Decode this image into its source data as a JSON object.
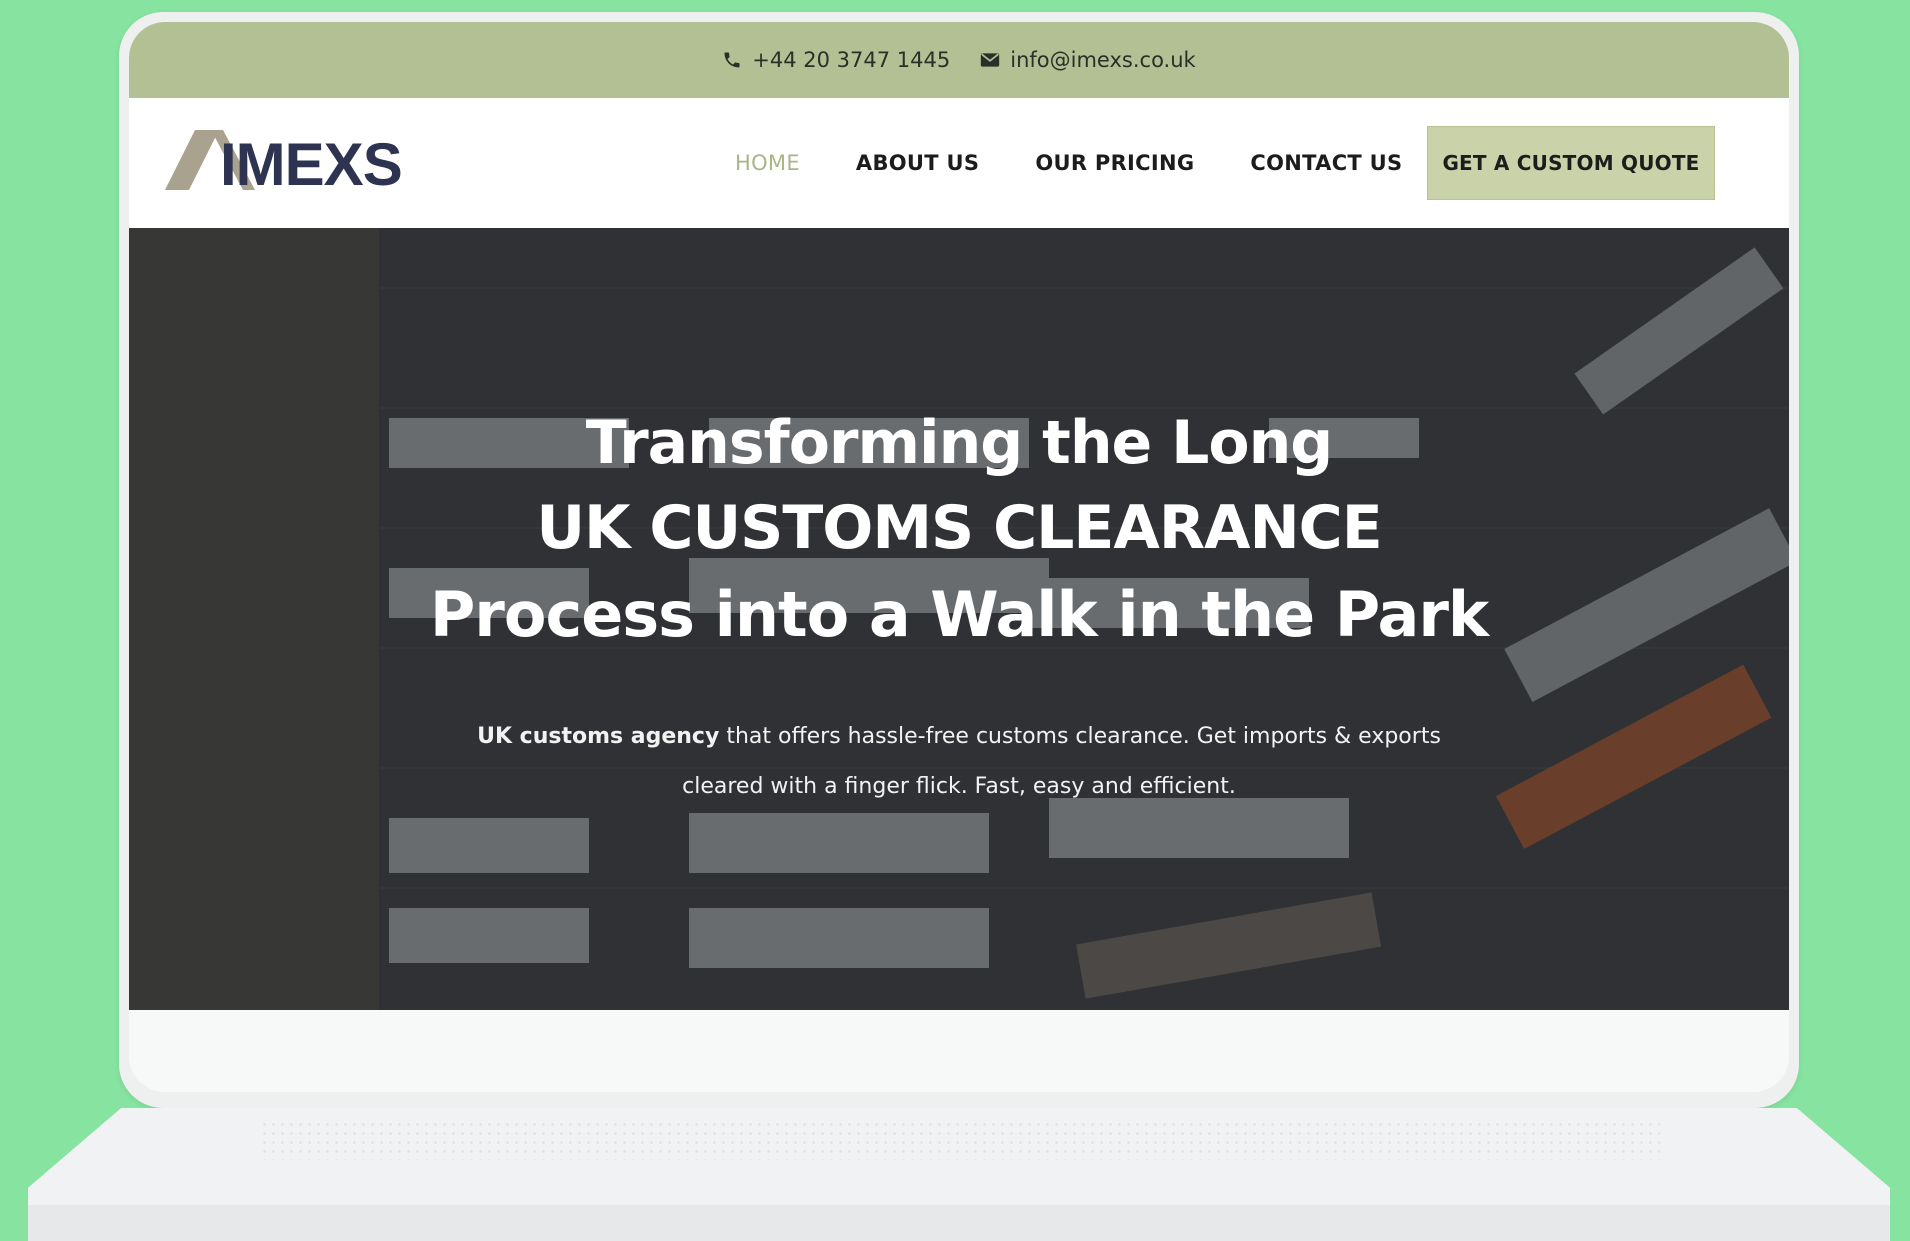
{
  "topbar": {
    "phone": "+44 20 3747 1445",
    "email": "info@imexs.co.uk",
    "phone_icon": "phone-icon",
    "email_icon": "envelope-icon"
  },
  "logo": {
    "text": "IMEXS"
  },
  "nav": {
    "items": [
      {
        "label": "HOME",
        "active": true
      },
      {
        "label": "ABOUT US"
      },
      {
        "label": "OUR PRICING"
      },
      {
        "label": "CONTACT US"
      }
    ],
    "cta": "GET A CUSTOM QUOTE"
  },
  "hero": {
    "title_line1": "Transforming the Long",
    "title_line2": "UK CUSTOMS CLEARANCE",
    "title_line3": "Process into a Walk in the Park",
    "subtitle_bold": "UK customs agency",
    "subtitle_rest": " that offers hassle-free customs clearance. Get imports & exports",
    "subtitle_line2": "cleared with a finger flick. Fast, easy and efficient."
  },
  "colors": {
    "background": "#86e3a0",
    "topbar": "#b3c093",
    "accent": "#a9b684",
    "cta": "#c9d2a9",
    "logo_navy": "#2d3350"
  }
}
